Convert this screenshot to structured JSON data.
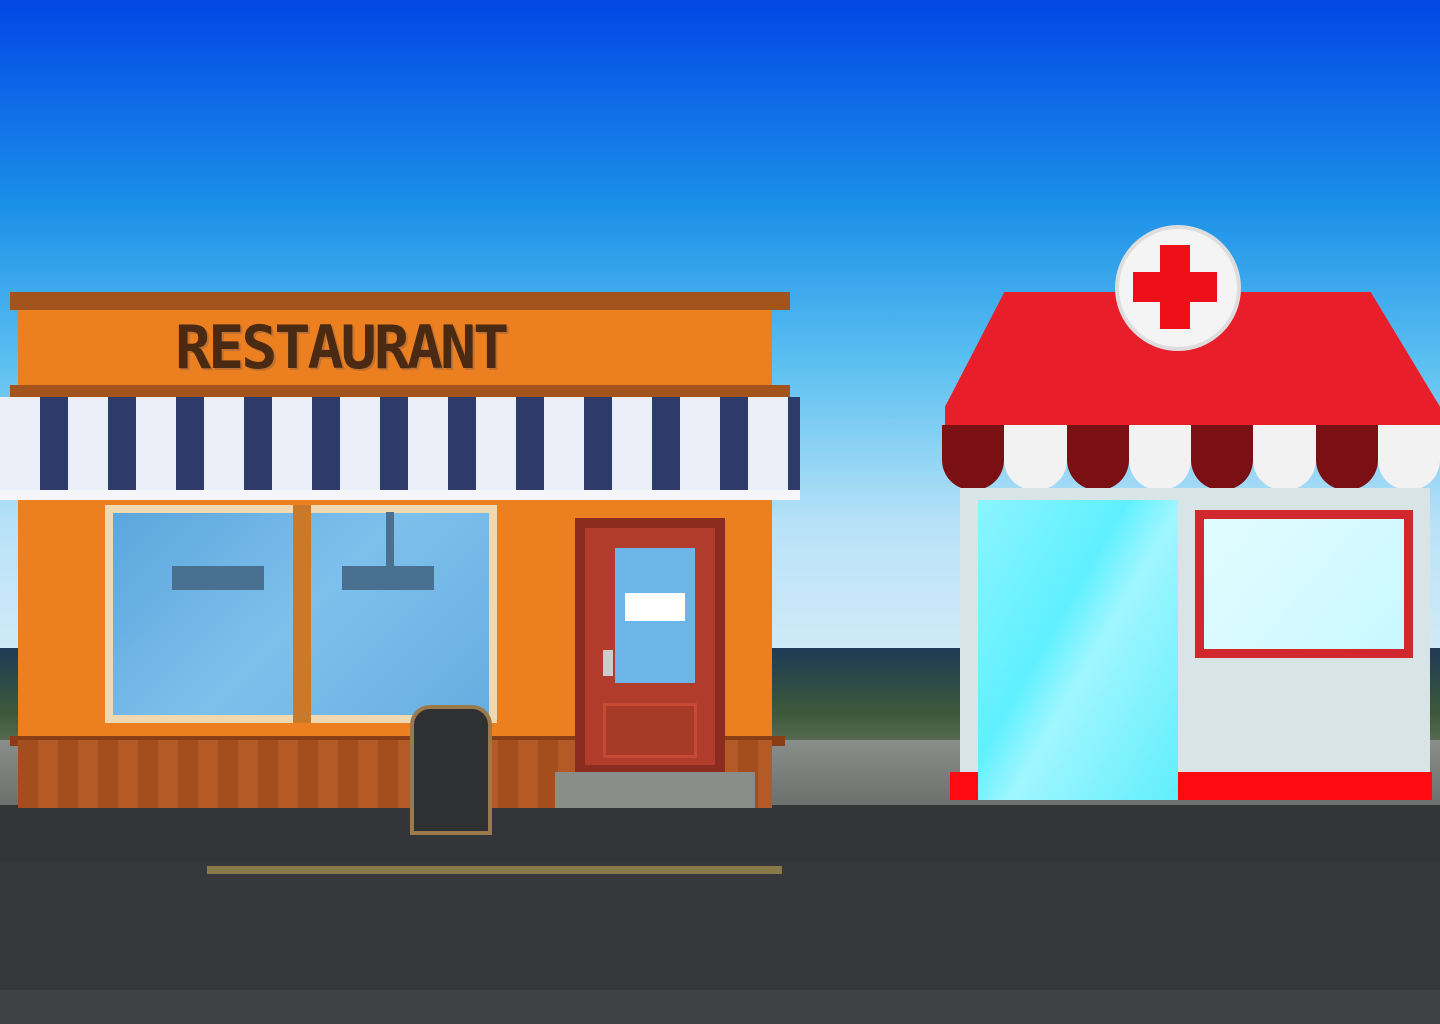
{
  "scene": {
    "restaurant_sign": "RESTAURANT",
    "pharmacy_symbol": "red-cross",
    "colors": {
      "sky_top": "#0346e6",
      "restaurant_orange": "#ec8020",
      "awning_navy": "#2f3b6b",
      "pharmacy_red": "#e81e2a",
      "road": "#333538"
    }
  }
}
